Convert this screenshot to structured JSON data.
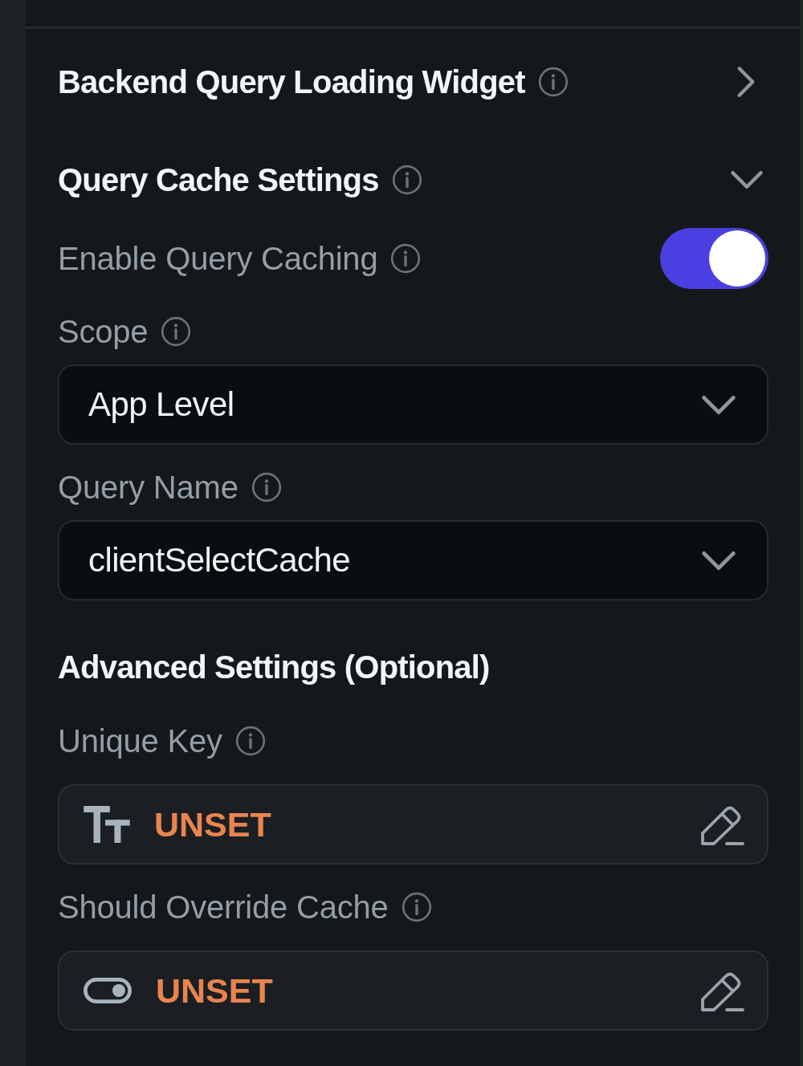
{
  "sections": [
    {
      "title": "Backend Query Loading Widget",
      "expanded": false
    },
    {
      "title": "Query Cache Settings",
      "expanded": true,
      "fields": [
        {
          "kind": "toggle",
          "label": "Enable Query Caching",
          "on": true
        },
        {
          "kind": "dropdown",
          "label": "Scope",
          "value": "App Level"
        },
        {
          "kind": "dropdown",
          "label": "Query Name",
          "value": "clientSelectCache"
        },
        {
          "kind": "subheading",
          "label": "Advanced Settings (Optional)"
        },
        {
          "kind": "text",
          "label": "Unique Key",
          "value": "UNSET"
        },
        {
          "kind": "boolean",
          "label": "Should Override Cache",
          "value": "UNSET"
        }
      ]
    }
  ]
}
